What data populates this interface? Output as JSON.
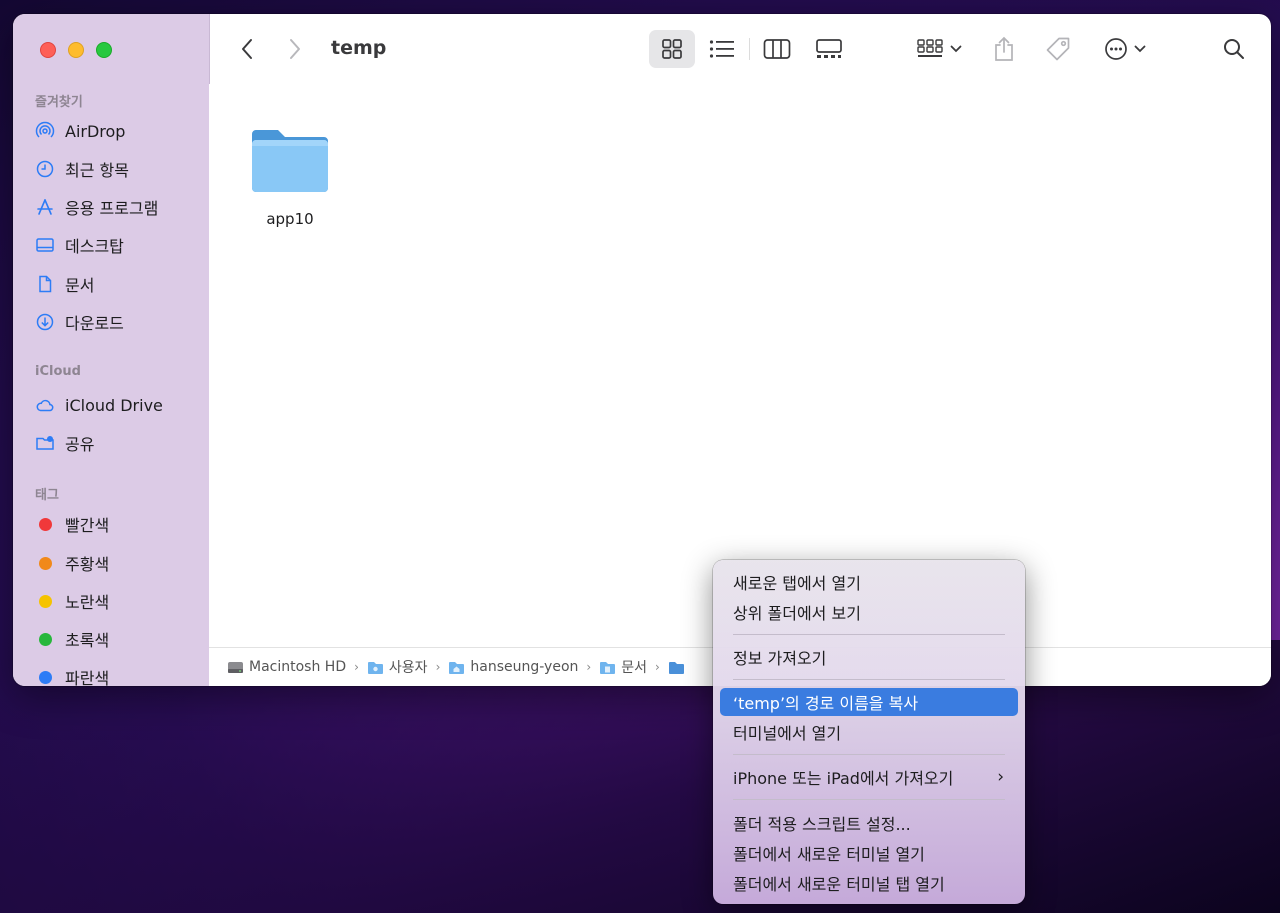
{
  "window": {
    "title": "temp"
  },
  "sidebar": {
    "favorites_title": "즐겨찾기",
    "favorites": [
      {
        "label": "AirDrop",
        "icon": "airdrop-icon"
      },
      {
        "label": "최근 항목",
        "icon": "clock-icon"
      },
      {
        "label": "응용 프로그램",
        "icon": "applications-icon"
      },
      {
        "label": "데스크탑",
        "icon": "desktop-icon"
      },
      {
        "label": "문서",
        "icon": "document-icon"
      },
      {
        "label": "다운로드",
        "icon": "download-icon"
      }
    ],
    "icloud_title": "iCloud",
    "icloud": [
      {
        "label": "iCloud Drive",
        "icon": "cloud-icon"
      },
      {
        "label": "공유",
        "icon": "shared-folder-icon"
      }
    ],
    "tags_title": "태그",
    "tags": [
      {
        "label": "빨간색",
        "color": "#f0383a"
      },
      {
        "label": "주황색",
        "color": "#f1891a"
      },
      {
        "label": "노란색",
        "color": "#f5c300"
      },
      {
        "label": "초록색",
        "color": "#28b73c"
      },
      {
        "label": "파란색",
        "color": "#2d7cf6"
      }
    ]
  },
  "content": {
    "items": [
      {
        "name": "app10",
        "icon": "folder-icon"
      }
    ]
  },
  "pathbar": {
    "crumbs": [
      {
        "label": "Macintosh HD",
        "icon": "hard-drive-icon"
      },
      {
        "label": "사용자",
        "icon": "users-folder-icon"
      },
      {
        "label": "hanseung-yeon",
        "icon": "home-folder-icon"
      },
      {
        "label": "문서",
        "icon": "documents-folder-icon"
      }
    ]
  },
  "context_menu": {
    "items": [
      {
        "label": "새로운 탭에서 열기"
      },
      {
        "label": "상위 폴더에서 보기"
      },
      {
        "label": "정보 가져오기"
      },
      {
        "label": "‘temp’의 경로 이름을 복사"
      },
      {
        "label": "터미널에서 열기"
      },
      {
        "label": "iPhone 또는 iPad에서 가져오기"
      },
      {
        "label": "폴더 적용 스크립트 설정..."
      },
      {
        "label": "폴더에서 새로운 터미널 열기"
      },
      {
        "label": "폴더에서 새로운 터미널 탭 열기"
      }
    ],
    "submenu_arrow": "›"
  },
  "colors": {
    "accent": "#3a7ce0",
    "sidebar_bg": "#dccbe6",
    "folder": "#6fb4ee"
  }
}
